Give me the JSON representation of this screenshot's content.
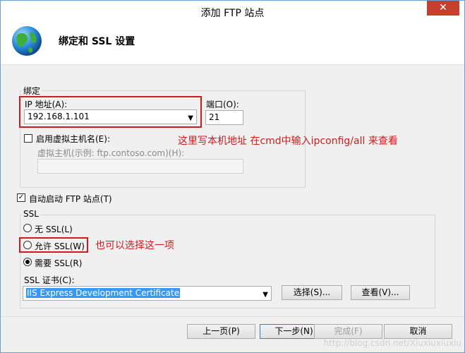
{
  "window": {
    "title": "添加 FTP 站点",
    "close_label": "✕"
  },
  "header": {
    "page_title": "绑定和 SSL 设置",
    "icon": "globe-icon"
  },
  "binding": {
    "group_label": "绑定",
    "ip_label": "IP 地址(A):",
    "ip_value": "192.168.1.101",
    "port_label": "端口(O):",
    "port_value": "21",
    "virtual_host_checkbox_label": "启用虚拟主机名(E):",
    "virtual_host_label": "虚拟主机(示例: ftp.contoso.com)(H):",
    "virtual_host_value": ""
  },
  "auto_start": {
    "label": "自动启动 FTP 站点(T)",
    "checked": true
  },
  "ssl": {
    "group_label": "SSL",
    "options": [
      {
        "label": "无 SSL(L)",
        "checked": false
      },
      {
        "label": "允许 SSL(W)",
        "checked": false
      },
      {
        "label": "需要 SSL(R)",
        "checked": true
      }
    ],
    "cert_label": "SSL 证书(C):",
    "cert_value": "IIS Express Development Certificate",
    "select_button": "选择(S)...",
    "view_button": "查看(V)..."
  },
  "annotations": {
    "ip_note": "这里写本机地址 在cmd中输入ipconfig/all 来查看",
    "ssl_note": "也可以选择这一项",
    "color": "#d11b1b"
  },
  "footer": {
    "prev": "上一页(P)",
    "next": "下一步(N)",
    "finish": "完成(F)",
    "cancel": "取消"
  },
  "watermark": "http://blog.csdn.net/Xiuxiuxiuxiu"
}
